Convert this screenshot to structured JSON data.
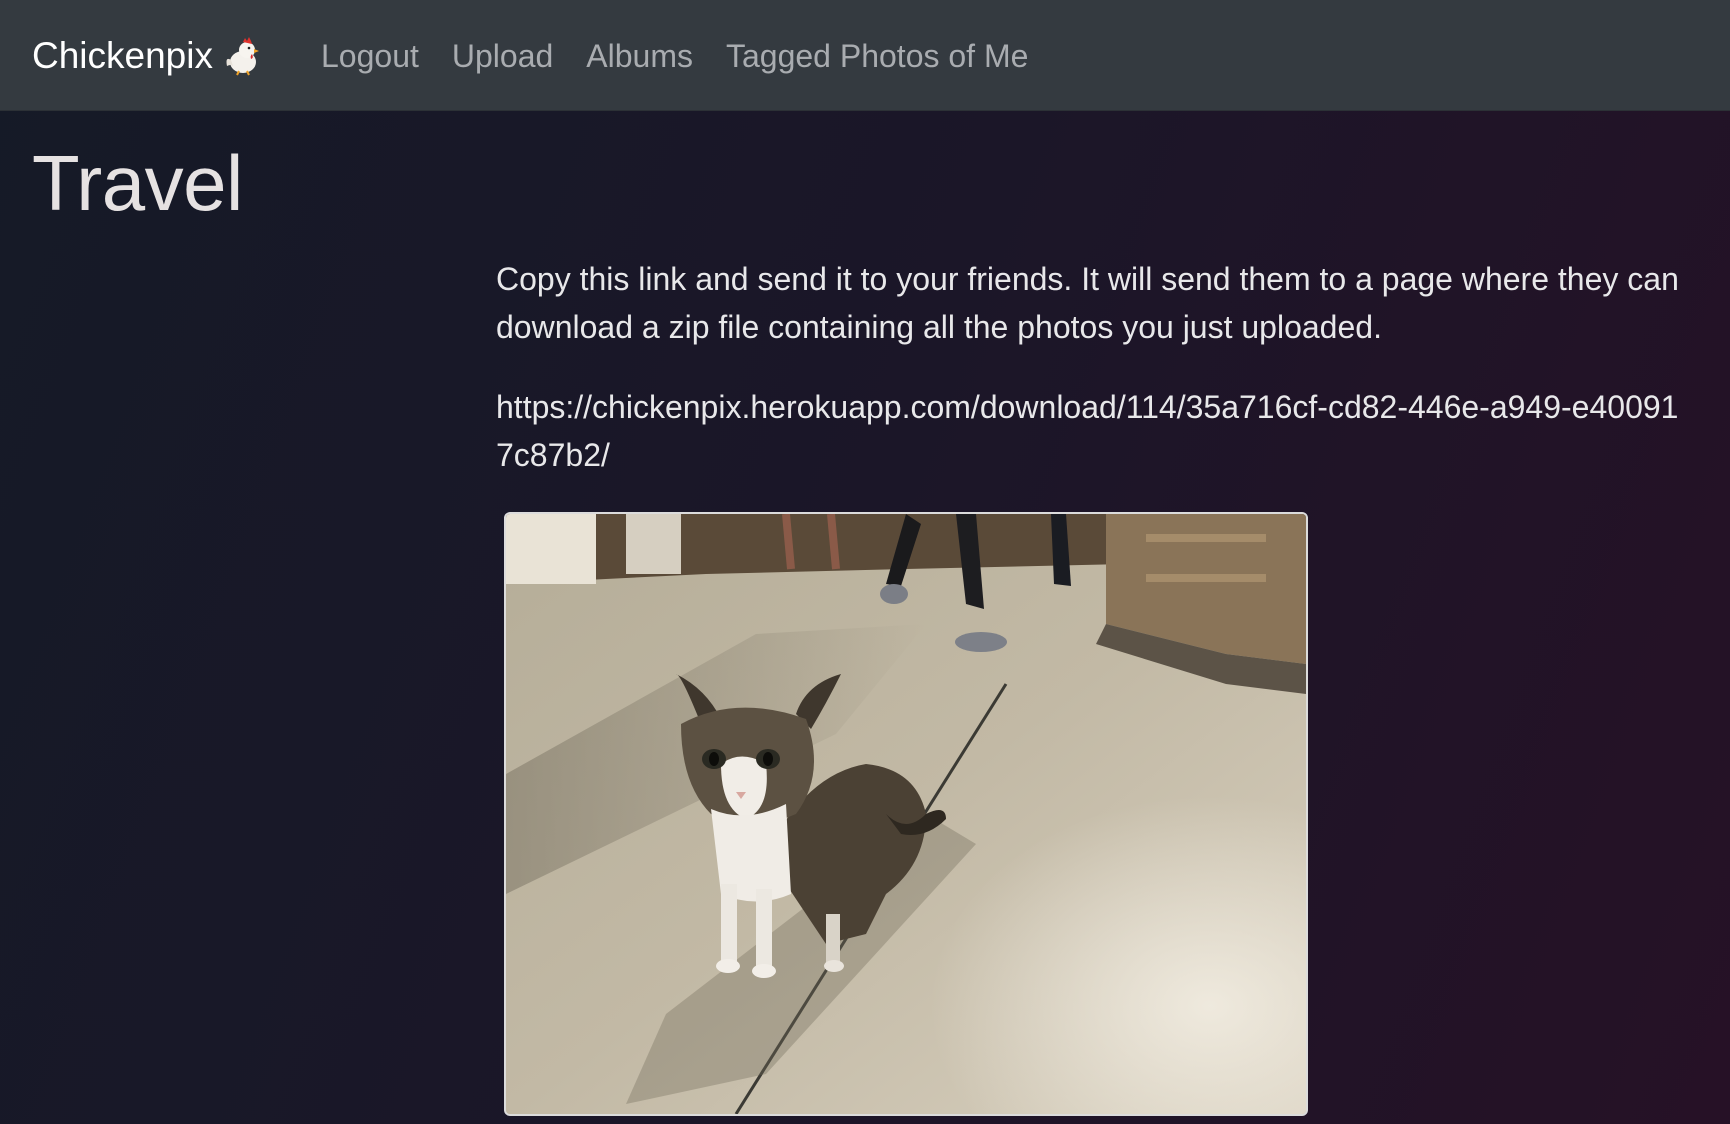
{
  "navbar": {
    "brand": "Chickenpix",
    "brand_icon": "chicken-icon",
    "links": [
      "Logout",
      "Upload",
      "Albums",
      "Tagged Photos of Me"
    ]
  },
  "page": {
    "title": "Travel"
  },
  "share": {
    "instructions": "Copy this link and send it to your friends. It will send them to a page where they can download a zip file containing all the photos you just uploaded.",
    "url": "https://chickenpix.herokuapp.com/download/114/35a716cf-cd82-446e-a949-e400917c87b2/"
  },
  "photo": {
    "subject": "cat-photo"
  },
  "colors": {
    "navbar_bg": "#343a40",
    "nav_link": "#a9acb0",
    "brand": "#ffffff",
    "page_bg_left": "#151a27",
    "page_bg_right": "#261126"
  }
}
